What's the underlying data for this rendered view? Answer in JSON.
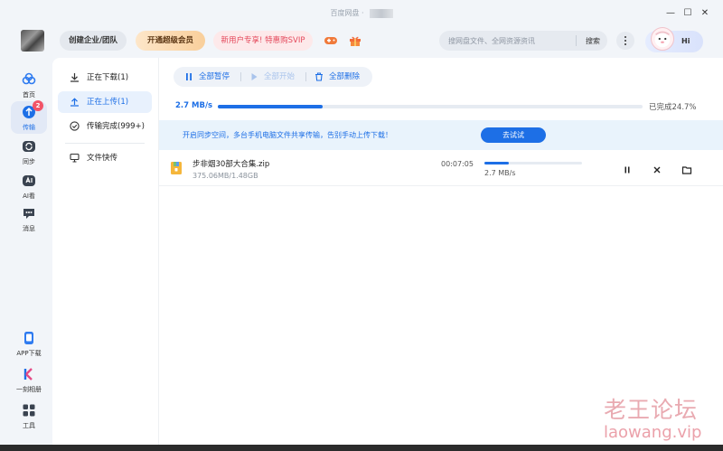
{
  "app": {
    "title": "百度网盘 ·"
  },
  "header": {
    "org_button": "创建企业/团队",
    "svip_button": "开通超级会员",
    "promo_button": "新用户专享! 特惠购SVIP",
    "search_placeholder": "搜网盘文件、全网资源资讯",
    "search_button": "搜索",
    "greeting": "Hi"
  },
  "leftnav": {
    "items": [
      {
        "label": "首页",
        "icon": "home-cloud-icon"
      },
      {
        "label": "传输",
        "icon": "transfer-icon",
        "badge": "2"
      },
      {
        "label": "同步",
        "icon": "sync-icon"
      },
      {
        "label": "AI看",
        "icon": "ai-icon"
      },
      {
        "label": "消息",
        "icon": "message-icon"
      }
    ],
    "bottom": [
      {
        "label": "APP下载",
        "icon": "phone-icon"
      },
      {
        "label": "一刻相册",
        "icon": "album-icon"
      },
      {
        "label": "工具",
        "icon": "tools-icon"
      }
    ]
  },
  "subnav": {
    "items": [
      {
        "label": "正在下载(1)",
        "icon": "download-icon"
      },
      {
        "label": "正在上传(1)",
        "icon": "upload-icon"
      },
      {
        "label": "传输完成(999+)",
        "icon": "check-circle-icon"
      },
      {
        "label": "文件快传",
        "icon": "monitor-icon"
      }
    ]
  },
  "toolbar": {
    "pause_all": "全部暂停",
    "start_all": "全部开始",
    "delete_all": "全部删除"
  },
  "summary": {
    "speed": "2.7 MB/s",
    "progress": 0.247,
    "done_text": "已完成24.7%"
  },
  "banner": {
    "text": "开启同步空间，多台手机电脑文件共享传输，告别手动上传下载！",
    "button": "去试试"
  },
  "transfers": [
    {
      "name": "步非烟30部大合集.zip",
      "size": "375.06MB/1.48GB",
      "eta": "00:07:05",
      "progress": 0.247,
      "speed": "2.7 MB/s"
    }
  ],
  "watermark": {
    "cn": "老王论坛",
    "en": "laowang.vip"
  },
  "colors": {
    "accent": "#1d6fe6",
    "badge": "#f25467",
    "banner_bg": "#e9f3fc"
  }
}
